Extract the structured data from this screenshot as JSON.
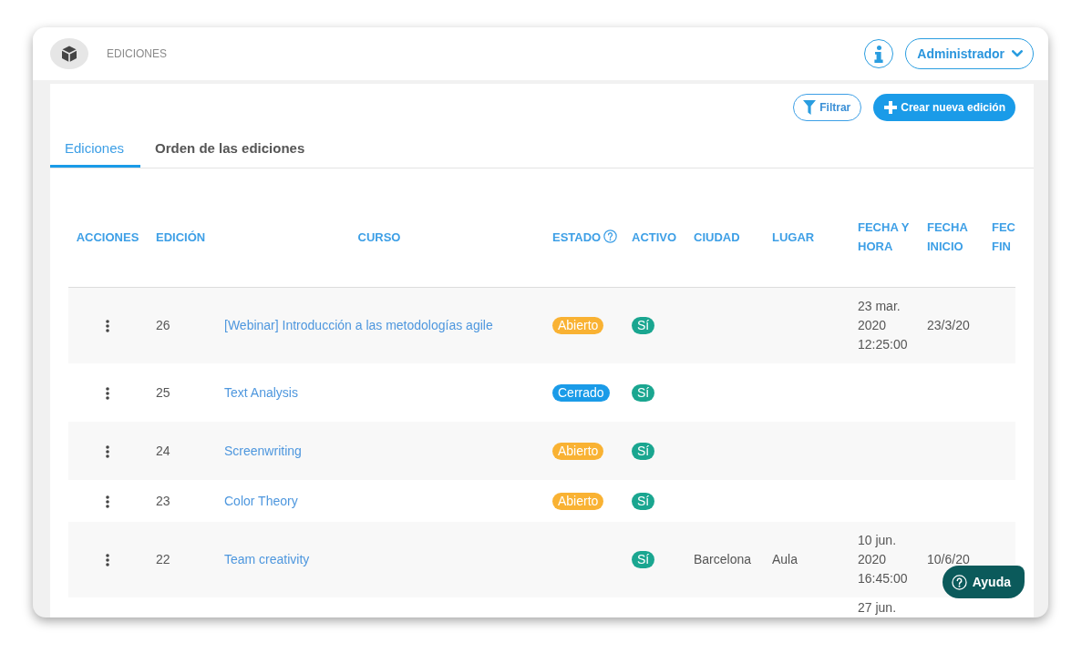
{
  "header": {
    "section_title": "EDICIONES",
    "user_menu": "Administrador"
  },
  "toolbar": {
    "filter_button": "Filtrar",
    "create_button": "Crear nueva edición"
  },
  "tabs": [
    {
      "label": "Ediciones",
      "selected": true
    },
    {
      "label": "Orden de las ediciones",
      "selected": false
    }
  ],
  "table": {
    "columns": [
      "ACCIONES",
      "EDICIÓN",
      "CURSO",
      "ESTADO",
      "ACTIVO",
      "CIUDAD",
      "LUGAR",
      "FECHA Y HORA",
      "FECHA INICIO",
      "FEC FIN"
    ],
    "rows": [
      {
        "edicion": "26",
        "curso": "[Webinar] Introducción a las metodologías agile",
        "estado": {
          "label": "Abierto",
          "color": "#f9b233"
        },
        "activo": {
          "label": "Sí",
          "color": "#1aa690"
        },
        "fecha_hora": "23 mar. 2020 12:25:00",
        "fecha_inicio": "23/3/20"
      },
      {
        "edicion": "25",
        "curso": "Text Analysis",
        "estado": {
          "label": "Cerrado",
          "color": "#1a9be8"
        },
        "activo": {
          "label": "Sí",
          "color": "#1aa690"
        }
      },
      {
        "edicion": "24",
        "curso": "Screenwriting",
        "estado": {
          "label": "Abierto",
          "color": "#f9b233"
        },
        "activo": {
          "label": "Sí",
          "color": "#1aa690"
        }
      },
      {
        "edicion": "23",
        "curso": "Color Theory",
        "estado": {
          "label": "Abierto",
          "color": "#f9b233"
        },
        "activo": {
          "label": "Sí",
          "color": "#1aa690"
        }
      },
      {
        "edicion": "22",
        "curso": "Team creativity",
        "activo": {
          "label": "Sí",
          "color": "#1aa690"
        },
        "ciudad": "Barcelona",
        "lugar": "Aula",
        "fecha_hora": "10 jun. 2020 16:45:00",
        "fecha_inicio": "10/6/20"
      },
      {
        "fecha_hora": "27 jun."
      }
    ]
  },
  "help_button": "Ayuda"
}
